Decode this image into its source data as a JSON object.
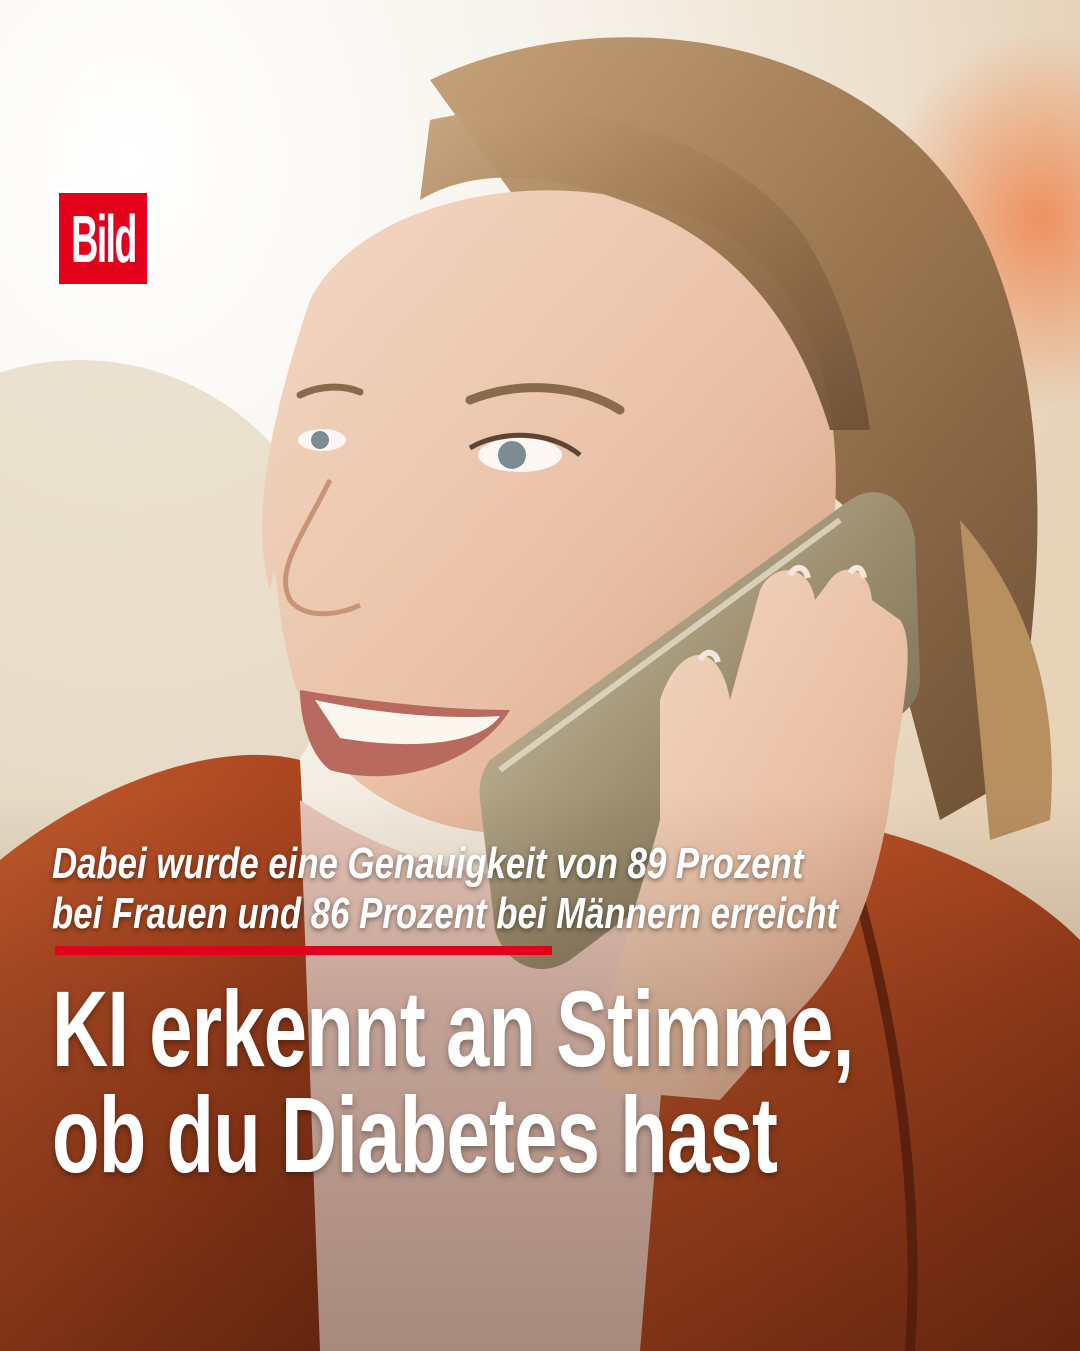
{
  "brand": {
    "logo_text": "Bild",
    "logo_color": "#e3001b"
  },
  "subheadline": {
    "line1": "Dabei wurde eine Genauigkeit von 89 Prozent",
    "line2": "bei Frauen und 86 Prozent bei Männern erreicht"
  },
  "headline": {
    "line1": "KI erkennt an Stimme,",
    "line2": "ob du Diabetes hast"
  },
  "accent_color": "#e3001b"
}
